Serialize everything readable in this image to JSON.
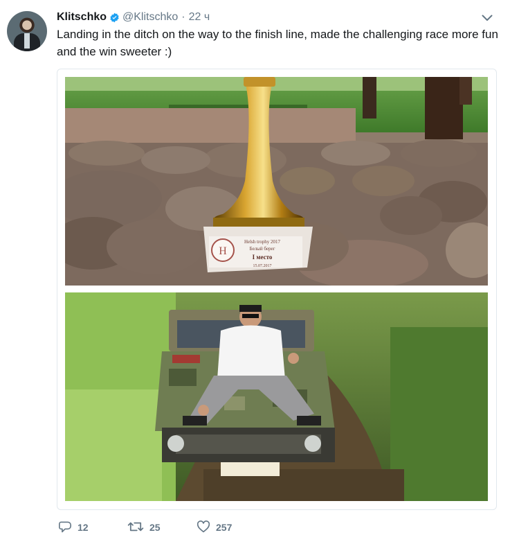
{
  "tweet": {
    "name": "Klitschko",
    "handle": "@Klitschko",
    "separator": "·",
    "time": "22 ч",
    "text": "Landing in the ditch on the way to the finish line, made the challenging race more fun and the win sweeter :)"
  },
  "trophy_plate": {
    "line1": "Helsh trophy 2017",
    "line2": "Белый берег",
    "line3": "I место",
    "line4": "15.07.2017"
  },
  "actions": {
    "replies": "12",
    "retweets": "25",
    "likes": "257"
  },
  "colors": {
    "verified": "#1da1f2",
    "secondary_text": "#657786",
    "border": "#e1e8ed"
  },
  "icons": [
    "verified-badge-icon",
    "chevron-down-icon",
    "reply-icon",
    "retweet-icon",
    "like-icon"
  ]
}
